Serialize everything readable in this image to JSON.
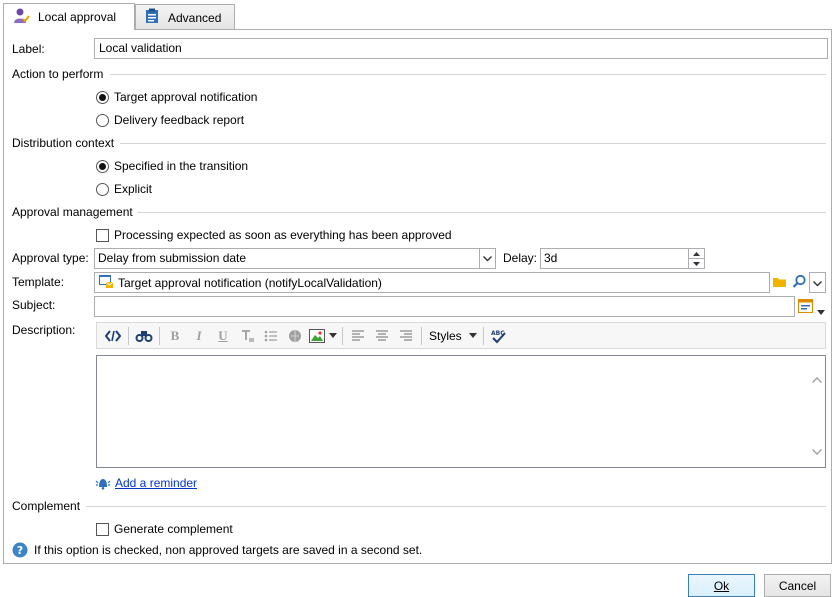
{
  "tabs": [
    {
      "label": "Local approval",
      "icon": "user-approval-icon",
      "active": true
    },
    {
      "label": "Advanced",
      "icon": "clipboard-icon",
      "active": false
    }
  ],
  "form": {
    "label_label": "Label:",
    "label_value": "Local validation",
    "action_section": "Action to perform",
    "action_options": [
      "Target approval notification",
      "Delivery feedback report"
    ],
    "distribution_section": "Distribution context",
    "distribution_options": [
      "Specified in the transition",
      "Explicit"
    ],
    "approval_section": "Approval management",
    "processing_check_label": "Processing expected as soon as everything has been approved",
    "approval_type_label": "Approval type:",
    "approval_type_value": "Delay from submission date",
    "delay_label": "Delay:",
    "delay_value": "3d",
    "template_label": "Template:",
    "template_value": "Target approval notification (notifyLocalValidation)",
    "subject_label": "Subject:",
    "subject_value": "",
    "description_label": "Description:",
    "styles_label": "Styles",
    "add_reminder_label": "Add a reminder",
    "complement_section": "Complement",
    "generate_complement_label": "Generate complement",
    "info_text": "If this option is checked, non approved targets are saved in a second set."
  },
  "buttons": {
    "ok": "Ok",
    "cancel": "Cancel"
  },
  "colors": {
    "link": "#0033cc",
    "folder": "#f0b400",
    "info": "#3d84c6",
    "accent_blue": "#2e6fb7"
  }
}
